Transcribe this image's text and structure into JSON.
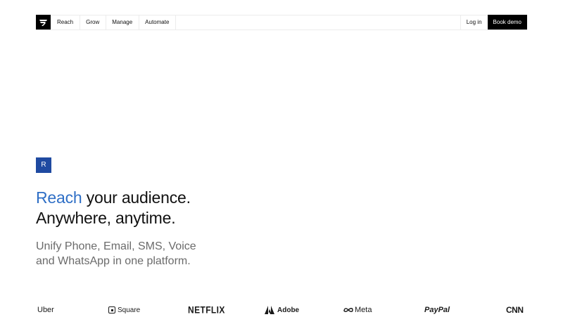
{
  "nav": {
    "logo_icon": "brand-logo-icon",
    "links": [
      {
        "label": "Reach"
      },
      {
        "label": "Grow"
      },
      {
        "label": "Manage"
      },
      {
        "label": "Automate"
      }
    ],
    "login_label": "Log in",
    "book_demo_label": "Book demo"
  },
  "hero": {
    "badge_letter": "R",
    "headline_accent": "Reach",
    "headline_line1_rest": " your audience.",
    "headline_line2": "Anywhere, anytime.",
    "subhead_line1": "Unify Phone, Email, SMS, Voice",
    "subhead_line2": "and WhatsApp in one platform."
  },
  "logos": {
    "uber": "Uber",
    "square": "Square",
    "netflix": "NETFLIX",
    "adobe": "Adobe",
    "meta": "Meta",
    "paypal": "PayPal",
    "cnn": "CNN"
  },
  "colors": {
    "accent": "#2f6fc6",
    "badge_bg": "#1f4aa1",
    "text": "#111111",
    "muted": "#6b6b6b",
    "button_bg": "#000000"
  }
}
